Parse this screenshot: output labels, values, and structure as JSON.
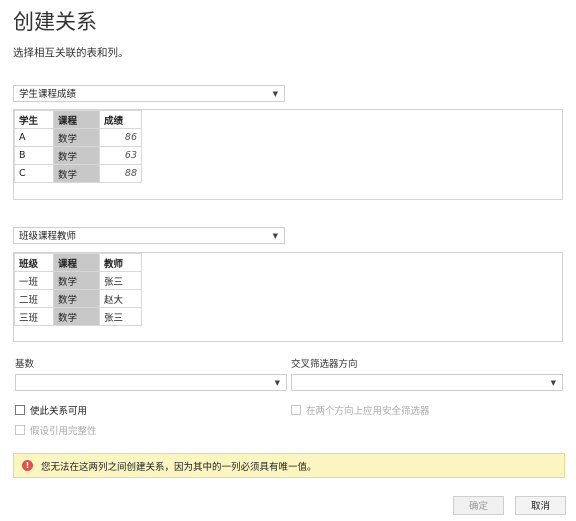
{
  "dialog": {
    "title": "创建关系",
    "subtitle": "选择相互关联的表和列。"
  },
  "table1": {
    "selector_value": "学生课程成绩",
    "headers": [
      "学生",
      "课程",
      "成绩"
    ],
    "rows": [
      [
        "A",
        "数学",
        "86"
      ],
      [
        "B",
        "数学",
        "63"
      ],
      [
        "C",
        "数学",
        "88"
      ]
    ]
  },
  "table2": {
    "selector_value": "班级课程教师",
    "headers": [
      "班级",
      "课程",
      "教师"
    ],
    "rows": [
      [
        "一班",
        "数学",
        "张三"
      ],
      [
        "二班",
        "数学",
        "赵大"
      ],
      [
        "三班",
        "数学",
        "张三"
      ]
    ]
  },
  "options": {
    "cardinality_label": "基数",
    "cardinality_value": "",
    "crossfilter_label": "交叉筛选器方向",
    "crossfilter_value": "",
    "make_active_label": "使此关系可用",
    "assume_integrity_label": "假设引用完整性",
    "security_filter_label": "在两个方向上应用安全筛选器"
  },
  "warning": {
    "icon": "!",
    "message": "您无法在这两列之间创建关系，因为其中的一列必须具有唯一值。"
  },
  "buttons": {
    "ok_label": "确定",
    "cancel_label": "取消"
  },
  "colors": {
    "selected_column": "#c8c8c8",
    "warning_bg": "#fbf5c2",
    "warning_icon": "#d9534f"
  }
}
